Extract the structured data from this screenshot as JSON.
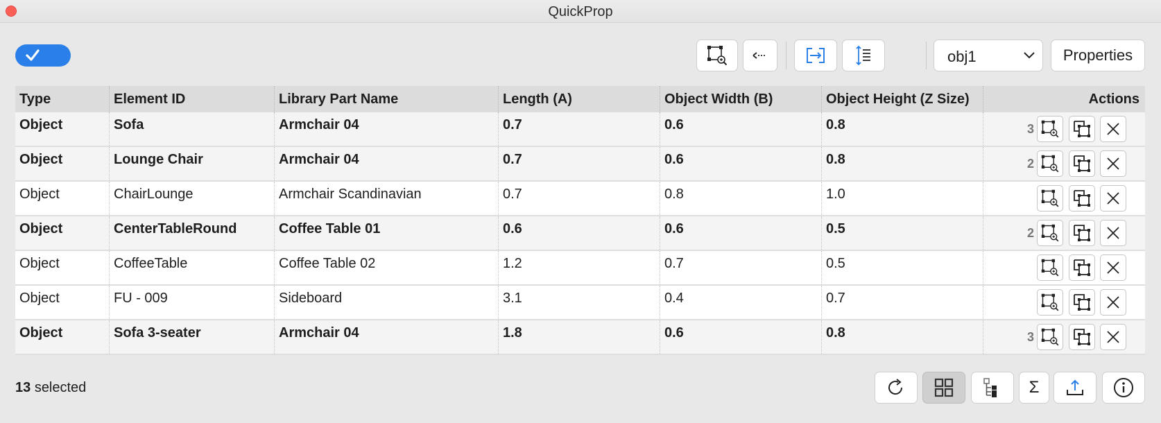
{
  "window": {
    "title": "QuickProp"
  },
  "toolbar": {
    "toggle_checked": true,
    "select_value": "obj1",
    "properties_label": "Properties",
    "icons": [
      "zoom-selection-icon",
      "collapse-left-icon",
      "transfer-icon",
      "row-height-icon",
      "chevron-down-icon"
    ]
  },
  "table": {
    "columns": [
      "Type",
      "Element ID",
      "Library Part Name",
      "Length (A)",
      "Object Width (B)",
      "Object Height (Z Size)",
      "Actions"
    ],
    "rows": [
      {
        "type": "Object",
        "element_id": "Sofa",
        "library_part": "Armchair 04",
        "length": "0.7",
        "width": "0.6",
        "height": "0.8",
        "count": "3",
        "bold": true
      },
      {
        "type": "Object",
        "element_id": "Lounge Chair",
        "library_part": "Armchair 04",
        "length": "0.7",
        "width": "0.6",
        "height": "0.8",
        "count": "2",
        "bold": true
      },
      {
        "type": "Object",
        "element_id": "ChairLounge",
        "library_part": "Armchair Scandinavian",
        "length": "0.7",
        "width": "0.8",
        "height": "1.0",
        "count": "",
        "bold": false
      },
      {
        "type": "Object",
        "element_id": "CenterTableRound",
        "library_part": "Coffee Table 01",
        "length": "0.6",
        "width": "0.6",
        "height": "0.5",
        "count": "2",
        "bold": true
      },
      {
        "type": "Object",
        "element_id": "CoffeeTable",
        "library_part": "Coffee Table 02",
        "length": "1.2",
        "width": "0.7",
        "height": "0.5",
        "count": "",
        "bold": false
      },
      {
        "type": "Object",
        "element_id": "FU - 009",
        "library_part": "Sideboard",
        "length": "3.1",
        "width": "0.4",
        "height": "0.7",
        "count": "",
        "bold": false
      },
      {
        "type": "Object",
        "element_id": "Sofa 3-seater",
        "library_part": "Armchair 04",
        "length": "1.8",
        "width": "0.6",
        "height": "0.8",
        "count": "3",
        "bold": true
      }
    ],
    "row_action_icons": [
      "zoom-selection-icon",
      "select-group-icon",
      "remove-icon"
    ]
  },
  "footer": {
    "selected_count": "13",
    "selected_label": "selected",
    "icons": [
      "refresh-icon",
      "grid-view-icon",
      "tree-view-icon",
      "sum-icon",
      "export-icon",
      "info-icon"
    ],
    "sum_glyph": "Σ"
  },
  "colors": {
    "accent": "#2b7fe9",
    "close": "#fe5f57",
    "header_bg": "#dcdcdc"
  }
}
